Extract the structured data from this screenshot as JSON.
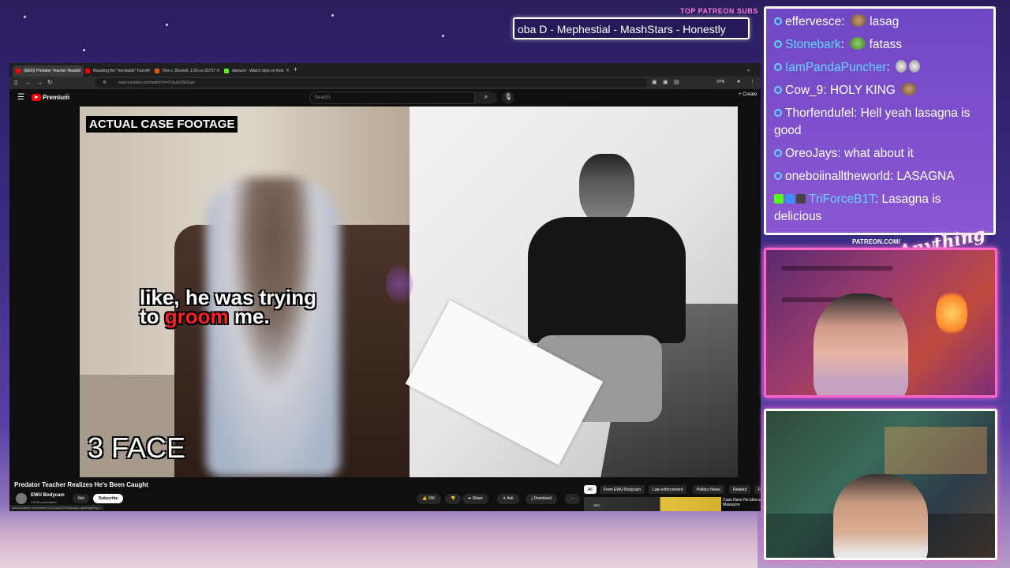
{
  "overlay": {
    "subs_title": "TOP PATREON SUBS",
    "subs_ticker": "oba D - Mephestial - MashStars - Honestly",
    "patreon_label": "PATREON.COM/",
    "brand_script": "Anything Else?"
  },
  "browser": {
    "tabs": [
      {
        "label": "(6820) Predator Teacher Realize",
        "favicon_color": "#ff0000"
      },
      {
        "label": "Roasting the \"Inevitable\" Fall to",
        "favicon_color": "#ff0000"
      },
      {
        "label": "Doe v. Bonnell, 1:25-cv-20757 -",
        "favicon_color": "#e05a00"
      },
      {
        "label": "daniuerl - Watch clips on Kick",
        "favicon_color": "#53fc18"
      }
    ],
    "new_tab": "+",
    "url": "www.youtube.com/watch?v=OJoaGOEGqw",
    "vpn_label": "VPN"
  },
  "youtube": {
    "logo_text": "Premium",
    "region": "CA",
    "search_placeholder": "Search",
    "create_label": "+ Create",
    "video": {
      "top_label": "ACTUAL CASE FOOTAGE",
      "caption_line1": "like, he was trying",
      "caption_line2_pre": "to ",
      "caption_line2_red": "groom",
      "caption_line2_post": " me.",
      "bottom_label": "3 FACE"
    },
    "title": "Predator Teacher Realizes He's Been Caught",
    "channel": {
      "name": "EWU Bodycam",
      "subscribers": "3.57M subscribers",
      "join": "Join",
      "subscribe": "Subscribe"
    },
    "status_url": "www.youtube.com/watch?v=OJoaGOEGqw&pp=ugUHagf6bg==",
    "actions": {
      "likes": "15K",
      "share": "Share",
      "ask": "Ask",
      "download": "Download",
      "more": "···"
    },
    "chips": [
      "All",
      "From EWU Bodycam",
      "Law enforcement",
      "Politics News",
      "Related",
      "F"
    ],
    "recommended": {
      "badge": "REC",
      "title": "Cops Have No Idea a Massacre"
    }
  },
  "chat": {
    "messages": [
      {
        "user": "effervesce",
        "user_color": "#ffffff",
        "text": "lasag",
        "badges": [],
        "emote": "burger"
      },
      {
        "user": "Stonebark",
        "user_color": "#5ed6ff",
        "text": "fatass",
        "badges": [],
        "emote": "frog"
      },
      {
        "user": "IamPandaPuncher",
        "user_color": "#5ed6ff",
        "text": "",
        "badges": [],
        "emote": "skulls"
      },
      {
        "user": "Cow_9",
        "user_color": "#ffffff",
        "text": "HOLY KING",
        "badges": [],
        "emote": "burger"
      },
      {
        "user": "Thorfendufel",
        "user_color": "#ffffff",
        "text": "Hell yeah lasagna is good",
        "badges": [],
        "emote": ""
      },
      {
        "user": "OreoJays",
        "user_color": "#ffffff",
        "text": "what about it",
        "badges": [],
        "emote": ""
      },
      {
        "user": "oneboiinalltheworld",
        "user_color": "#ffffff",
        "text": "LASAGNA",
        "badges": [],
        "emote": ""
      },
      {
        "user": "TriForceB1T",
        "user_color": "#5ed6ff",
        "text": "Lasagna is delicious",
        "badges": [
          "kick",
          "blue",
          "grey"
        ],
        "emote": ""
      }
    ]
  }
}
